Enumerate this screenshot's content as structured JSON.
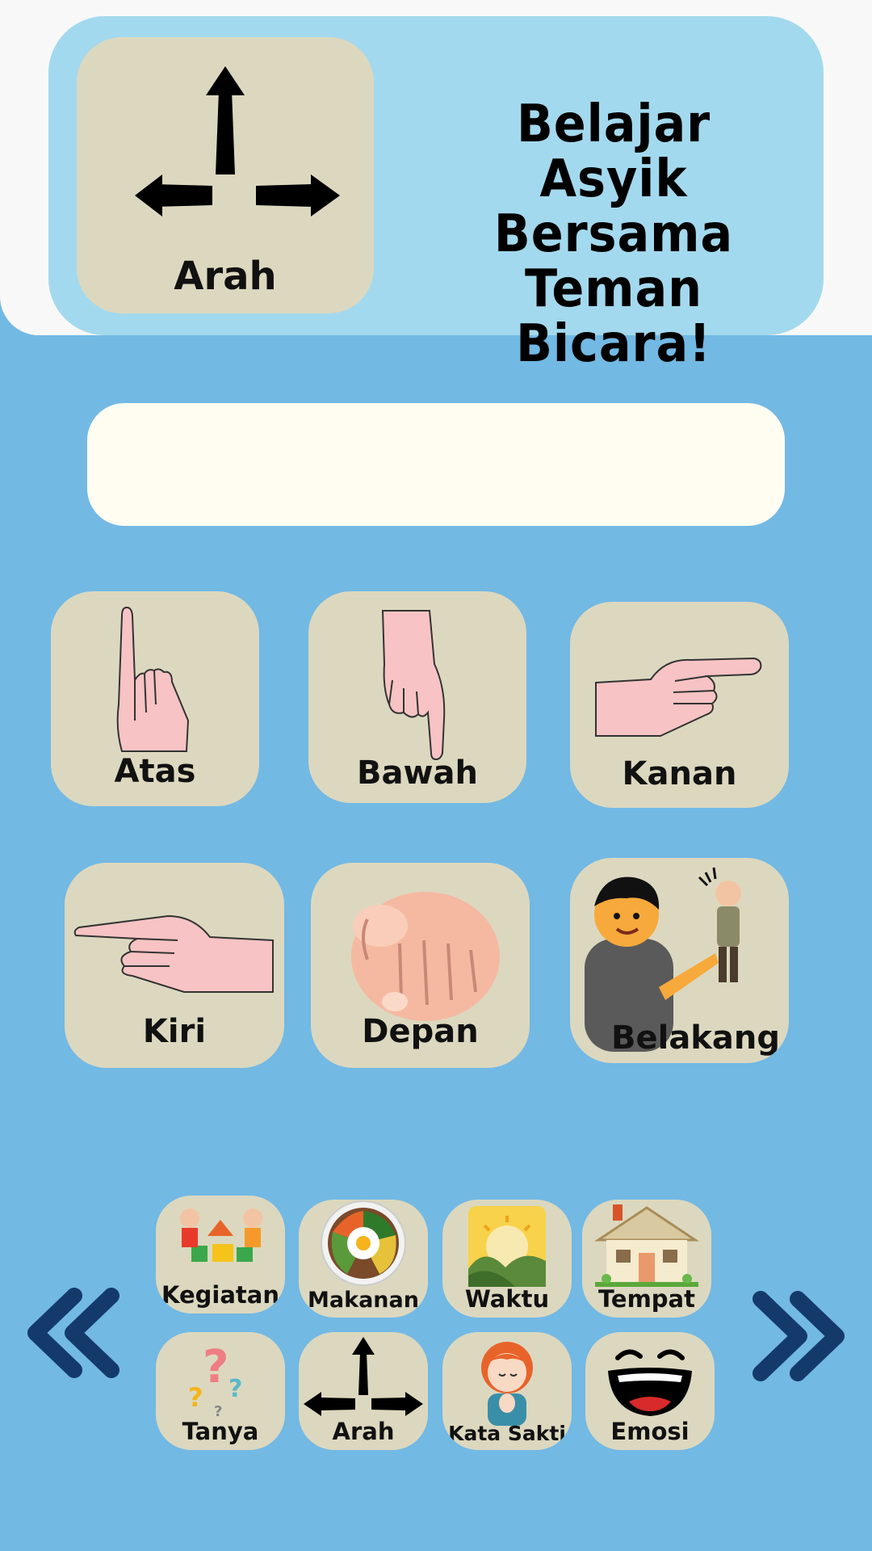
{
  "header": {
    "category_label": "Arah",
    "title_lines": [
      "Belajar Asyik",
      "Bersama",
      "Teman Bicara!"
    ]
  },
  "sentence_bar": {
    "text": ""
  },
  "words": [
    {
      "label": "Atas",
      "icon": "pointing-up-hand-icon"
    },
    {
      "label": "Bawah",
      "icon": "pointing-down-hand-icon"
    },
    {
      "label": "Kanan",
      "icon": "pointing-right-hand-icon"
    },
    {
      "label": "Kiri",
      "icon": "pointing-left-hand-icon"
    },
    {
      "label": "Depan",
      "icon": "pointing-forward-fist-icon"
    },
    {
      "label": "Belakang",
      "icon": "person-pointing-behind-icon"
    }
  ],
  "categories": [
    {
      "label": "Kegiatan",
      "icon": "children-playing-icon"
    },
    {
      "label": "Makanan",
      "icon": "food-bowl-icon"
    },
    {
      "label": "Waktu",
      "icon": "sun-mountain-icon"
    },
    {
      "label": "Tempat",
      "icon": "house-icon"
    },
    {
      "label": "Tanya",
      "icon": "question-marks-icon"
    },
    {
      "label": "Arah",
      "icon": "arrows-icon"
    },
    {
      "label": "Kata Sakti",
      "icon": "girl-praying-icon"
    },
    {
      "label": "Emosi",
      "icon": "laughing-face-icon"
    }
  ],
  "navigation": {
    "prev_icon": "double-chevron-left-icon",
    "next_icon": "double-chevron-right-icon"
  },
  "colors": {
    "background": "#72b9e4",
    "header_panel": "#a3d9ee",
    "card": "#dcd8bf",
    "sentence_bar": "#fffdf1",
    "nav_arrow": "#143a6b"
  }
}
